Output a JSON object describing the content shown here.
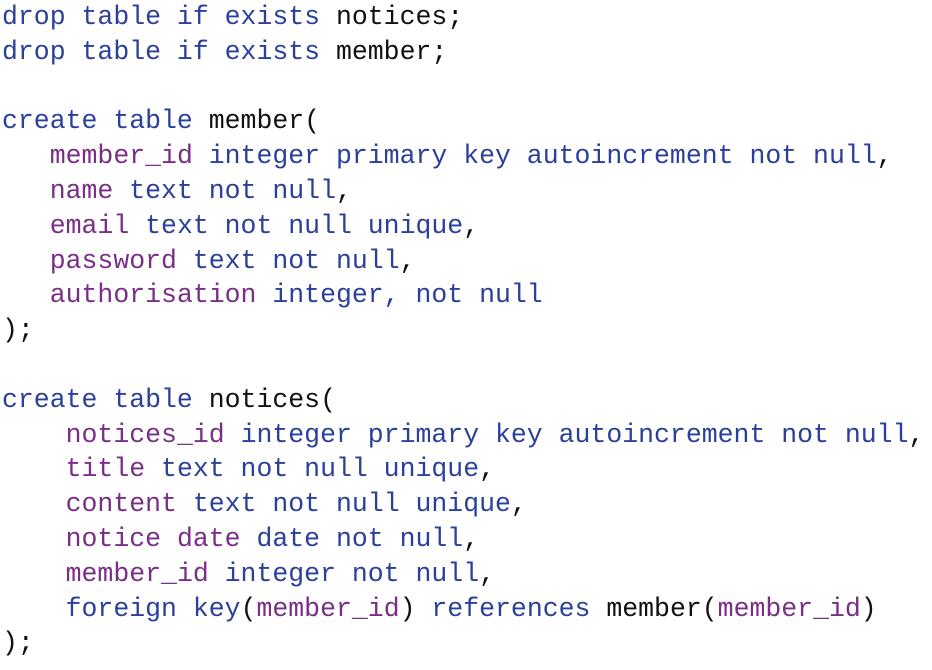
{
  "colors": {
    "keyword": "#2b3f9c",
    "identifier": "#7a2f86",
    "plain": "#111111",
    "background": "#ffffff"
  },
  "code": {
    "lines": [
      [
        {
          "t": "kw",
          "s": "drop table if exists"
        },
        {
          "t": "pl",
          "s": " notices;"
        }
      ],
      [
        {
          "t": "kw",
          "s": "drop table if exists"
        },
        {
          "t": "pl",
          "s": " member;"
        }
      ],
      [],
      [
        {
          "t": "kw",
          "s": "create table"
        },
        {
          "t": "pl",
          "s": " member("
        }
      ],
      [
        {
          "t": "pl",
          "s": "   "
        },
        {
          "t": "id",
          "s": "member_id"
        },
        {
          "t": "pl",
          "s": " "
        },
        {
          "t": "kw",
          "s": "integer primary key autoincrement not null"
        },
        {
          "t": "pl",
          "s": ","
        }
      ],
      [
        {
          "t": "pl",
          "s": "   "
        },
        {
          "t": "id",
          "s": "name"
        },
        {
          "t": "pl",
          "s": " "
        },
        {
          "t": "kw",
          "s": "text not null"
        },
        {
          "t": "pl",
          "s": ","
        }
      ],
      [
        {
          "t": "pl",
          "s": "   "
        },
        {
          "t": "id",
          "s": "email"
        },
        {
          "t": "pl",
          "s": " "
        },
        {
          "t": "kw",
          "s": "text not null unique"
        },
        {
          "t": "pl",
          "s": ","
        }
      ],
      [
        {
          "t": "pl",
          "s": "   "
        },
        {
          "t": "id",
          "s": "password"
        },
        {
          "t": "pl",
          "s": " "
        },
        {
          "t": "kw",
          "s": "text not null"
        },
        {
          "t": "pl",
          "s": ","
        }
      ],
      [
        {
          "t": "pl",
          "s": "   "
        },
        {
          "t": "id",
          "s": "authorisation"
        },
        {
          "t": "pl",
          "s": " "
        },
        {
          "t": "kw",
          "s": "integer, not null"
        }
      ],
      [
        {
          "t": "pl",
          "s": ");"
        }
      ],
      [],
      [
        {
          "t": "kw",
          "s": "create table"
        },
        {
          "t": "pl",
          "s": " notices("
        }
      ],
      [
        {
          "t": "pl",
          "s": "    "
        },
        {
          "t": "id",
          "s": "notices_id"
        },
        {
          "t": "pl",
          "s": " "
        },
        {
          "t": "kw",
          "s": "integer primary key autoincrement not null"
        },
        {
          "t": "pl",
          "s": ","
        }
      ],
      [
        {
          "t": "pl",
          "s": "    "
        },
        {
          "t": "id",
          "s": "title"
        },
        {
          "t": "pl",
          "s": " "
        },
        {
          "t": "kw",
          "s": "text not null unique"
        },
        {
          "t": "pl",
          "s": ","
        }
      ],
      [
        {
          "t": "pl",
          "s": "    "
        },
        {
          "t": "id",
          "s": "content"
        },
        {
          "t": "pl",
          "s": " "
        },
        {
          "t": "kw",
          "s": "text not null unique"
        },
        {
          "t": "pl",
          "s": ","
        }
      ],
      [
        {
          "t": "pl",
          "s": "    "
        },
        {
          "t": "id",
          "s": "notice date"
        },
        {
          "t": "pl",
          "s": " "
        },
        {
          "t": "kw",
          "s": "date not null"
        },
        {
          "t": "pl",
          "s": ","
        }
      ],
      [
        {
          "t": "pl",
          "s": "    "
        },
        {
          "t": "id",
          "s": "member_id"
        },
        {
          "t": "pl",
          "s": " "
        },
        {
          "t": "kw",
          "s": "integer not null"
        },
        {
          "t": "pl",
          "s": ","
        }
      ],
      [
        {
          "t": "pl",
          "s": "    "
        },
        {
          "t": "kw",
          "s": "foreign key"
        },
        {
          "t": "pl",
          "s": "("
        },
        {
          "t": "id",
          "s": "member_id"
        },
        {
          "t": "pl",
          "s": ") "
        },
        {
          "t": "kw",
          "s": "references"
        },
        {
          "t": "pl",
          "s": " member("
        },
        {
          "t": "id",
          "s": "member_id"
        },
        {
          "t": "pl",
          "s": ")"
        }
      ],
      [
        {
          "t": "pl",
          "s": ");"
        }
      ]
    ]
  }
}
